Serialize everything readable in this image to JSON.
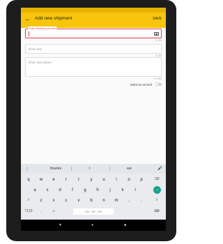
{
  "appbar": {
    "title": "Add new shipment",
    "save_label": "SAVE"
  },
  "form": {
    "tracking_label": "Enter tracking number",
    "tracking_counter": "0 / 50",
    "title_placeholder": "Enter title",
    "title_counter": "0 / 50",
    "desc_placeholder": "Enter description",
    "desc_counter": "0 / 500",
    "arrival_label": "Mark as arrived"
  },
  "keyboard": {
    "suggestions": [
      "thanks",
      "I",
      "we"
    ],
    "row1": [
      "q",
      "w",
      "e",
      "r",
      "t",
      "y",
      "u",
      "i",
      "o",
      "p"
    ],
    "row2": [
      "a",
      "s",
      "d",
      "f",
      "g",
      "h",
      "j",
      "k",
      "l"
    ],
    "row3": [
      "z",
      "x",
      "c",
      "v",
      "b",
      "n",
      "m"
    ],
    "symbols_label": "?123",
    "comma": ",",
    "period": ".",
    "space_label": "EN · HE · ES"
  },
  "colors": {
    "accent": "#f6c50c",
    "error": "#d93f4c",
    "enter": "#1aa18a"
  }
}
